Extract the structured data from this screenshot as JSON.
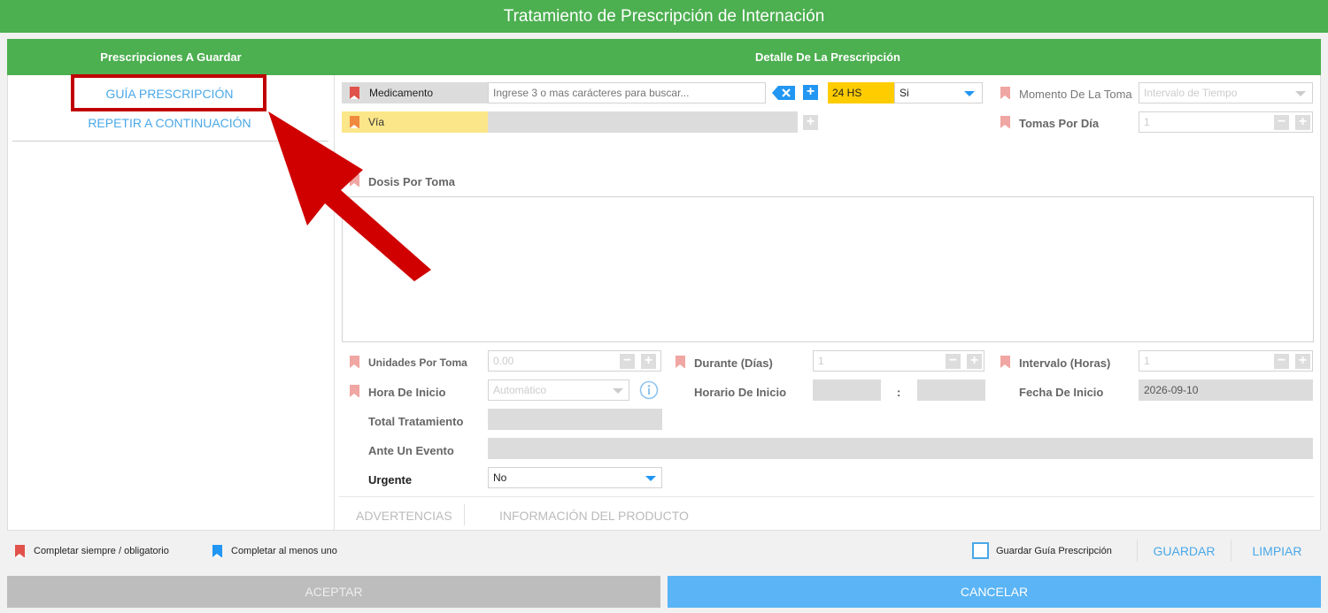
{
  "window": {
    "title": "Tratamiento de Prescripción de Internación"
  },
  "left_panel": {
    "header": "Prescripciones A Guardar",
    "guia_button": "GUÍA PRESCRIPCIÓN",
    "repetir_button": "REPETIR A CONTINUACIÓN"
  },
  "detail": {
    "header": "Detalle De La Prescripción",
    "medicamento": {
      "label": "Medicamento",
      "placeholder": "Ingrese 3 o mas carácteres para buscar..."
    },
    "hs_badge": "24 HS",
    "si_select": "Si",
    "via": {
      "label": "Vía"
    },
    "momento": {
      "label": "Momento De La Toma",
      "value": "Intervalo de Tiempo"
    },
    "tomas": {
      "label": "Tomas Por Día",
      "value": "1"
    },
    "dosis": {
      "label": "Dosis Por Toma"
    },
    "unidades": {
      "label": "Unidades Por Toma",
      "value": "0.00"
    },
    "durante": {
      "label": "Durante (Días)",
      "value": "1"
    },
    "intervalo": {
      "label": "Intervalo (Horas)",
      "value": "1"
    },
    "hora_inicio": {
      "label": "Hora De Inicio",
      "value": "Automático"
    },
    "horario_inicio": {
      "label": "Horario De Inicio",
      "sep": ":"
    },
    "fecha_inicio": {
      "label": "Fecha De Inicio",
      "value": "2026-09-10"
    },
    "total": {
      "label": "Total Tratamiento"
    },
    "evento": {
      "label": "Ante Un Evento"
    },
    "urgente": {
      "label": "Urgente",
      "value": "No"
    },
    "tabs": [
      "ADVERTENCIAS",
      "INFORMACIÓN DEL PRODUCTO"
    ]
  },
  "legend": {
    "mandatory": "Completar siempre / obligatorio",
    "at_least_one": "Completar al menos uno",
    "guardar_guia": "Guardar Guía Prescripción",
    "guardar": "GUARDAR",
    "limpiar": "LIMPIAR"
  },
  "footer": {
    "aceptar": "ACEPTAR",
    "cancelar": "CANCELAR"
  },
  "colors": {
    "header_green": "#4caf50",
    "link_blue": "#4aa8e8",
    "accent_blue": "#2196f3",
    "badge_yellow": "#ffcc00",
    "highlight_yellow": "#fce68a",
    "annotation_red": "#c00000"
  }
}
